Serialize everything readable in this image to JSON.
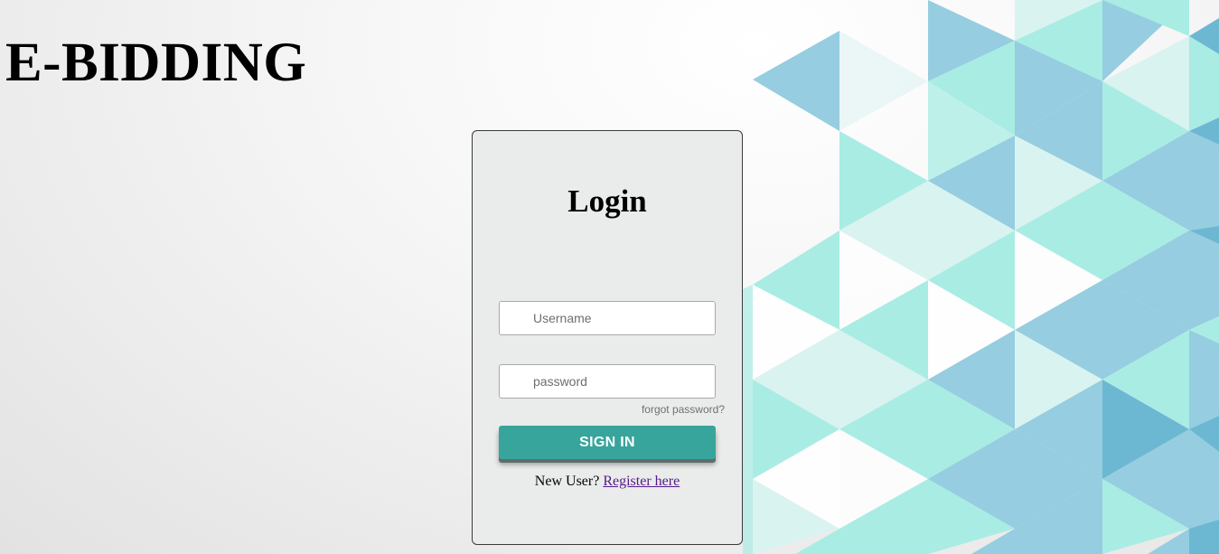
{
  "app": {
    "title": "E-BIDDING"
  },
  "login": {
    "title": "Login",
    "username_placeholder": "Username",
    "username_value": "",
    "password_placeholder": "password",
    "password_value": "",
    "forgot_label": "forgot password?",
    "signin_label": "SIGN IN",
    "new_user_label": "New User?",
    "register_label": "Register here"
  },
  "colors": {
    "signin_button": "#38a59c",
    "link_visited": "#551a8b",
    "card_background": "#eaeceb",
    "pattern_blue": "#96cde0",
    "pattern_teal": "#a9ece4",
    "pattern_light": "#d9f3f0"
  }
}
